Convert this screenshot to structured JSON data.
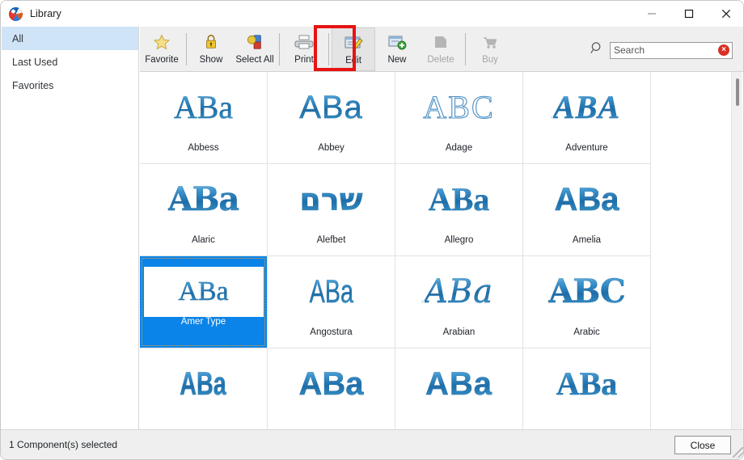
{
  "window": {
    "title": "Library",
    "app_icon": "library-app-icon",
    "minimize_label": "Minimize",
    "maximize_label": "Maximize",
    "close_label": "Close"
  },
  "sidebar": {
    "items": [
      {
        "label": "All",
        "active": true
      },
      {
        "label": "Last Used",
        "active": false
      },
      {
        "label": "Favorites",
        "active": false
      }
    ]
  },
  "toolbar": {
    "groups": [
      {
        "items": [
          {
            "label": "Favorite",
            "icon": "star-icon",
            "disabled": false,
            "selected": false
          }
        ]
      },
      {
        "items": [
          {
            "label": "Show",
            "icon": "lock-icon",
            "disabled": false,
            "selected": false
          },
          {
            "label": "Select All",
            "icon": "cubes-icon",
            "disabled": false,
            "selected": false
          }
        ]
      },
      {
        "items": [
          {
            "label": "Print",
            "icon": "printer-icon",
            "disabled": false,
            "selected": false
          }
        ]
      },
      {
        "items": [
          {
            "label": "Edit",
            "icon": "edit-pencil-icon",
            "disabled": false,
            "selected": true
          },
          {
            "label": "New",
            "icon": "new-document-icon",
            "disabled": false,
            "selected": false
          },
          {
            "label": "Delete",
            "icon": "delete-icon",
            "disabled": true,
            "selected": false
          }
        ]
      },
      {
        "items": [
          {
            "label": "Buy",
            "icon": "cart-icon",
            "disabled": true,
            "selected": false
          }
        ]
      }
    ],
    "highlight": {
      "target": "Edit",
      "color": "#e81313"
    }
  },
  "search": {
    "icon": "magnifier-icon",
    "placeholder": "Search",
    "value": "",
    "clear_icon": "clear-circle-icon",
    "clear_glyph": "×"
  },
  "grid": {
    "items": [
      {
        "name": "Abbess",
        "sample": "ABa",
        "style": "serif",
        "selected": false
      },
      {
        "name": "Abbey",
        "sample": "ABa",
        "style": "sans wide",
        "selected": false
      },
      {
        "name": "Adage",
        "sample": "ABC",
        "style": "outline",
        "selected": false
      },
      {
        "name": "Adventure",
        "sample": "ABA",
        "style": "serif ital bold",
        "selected": false
      },
      {
        "name": "Alaric",
        "sample": "ABa",
        "style": "black",
        "selected": false
      },
      {
        "name": "Alefbet",
        "sample": "שרם",
        "style": "heb",
        "selected": false
      },
      {
        "name": "Allegro",
        "sample": "ABa",
        "style": "serif bold",
        "selected": false
      },
      {
        "name": "Amelia",
        "sample": "ABa",
        "style": "sans bold",
        "selected": false
      },
      {
        "name": "Amer Type",
        "sample": "ABa",
        "style": "serif",
        "selected": true
      },
      {
        "name": "Angostura",
        "sample": "ABa",
        "style": "sans cond",
        "selected": false
      },
      {
        "name": "Arabian",
        "sample": "ABa",
        "style": "script",
        "selected": false
      },
      {
        "name": "Arabic",
        "sample": "ABC",
        "style": "black wide",
        "selected": false
      },
      {
        "name": "",
        "sample": "ABa",
        "style": "sans cond",
        "selected": false
      },
      {
        "name": "",
        "sample": "ABa",
        "style": "sans bold",
        "selected": false
      },
      {
        "name": "",
        "sample": "ABa",
        "style": "sans bold wide",
        "selected": false
      },
      {
        "name": "",
        "sample": "ABa",
        "style": "serif bold",
        "selected": false
      }
    ]
  },
  "statusbar": {
    "status_text": "1 Component(s) selected",
    "close_button": "Close"
  },
  "colors": {
    "selection_blue": "#0a84e8",
    "sidebar_active": "#cfe4f7",
    "highlight_red": "#e81313",
    "toolbar_bg": "#efefef",
    "embroidery_blue": "#1d6ea8"
  }
}
